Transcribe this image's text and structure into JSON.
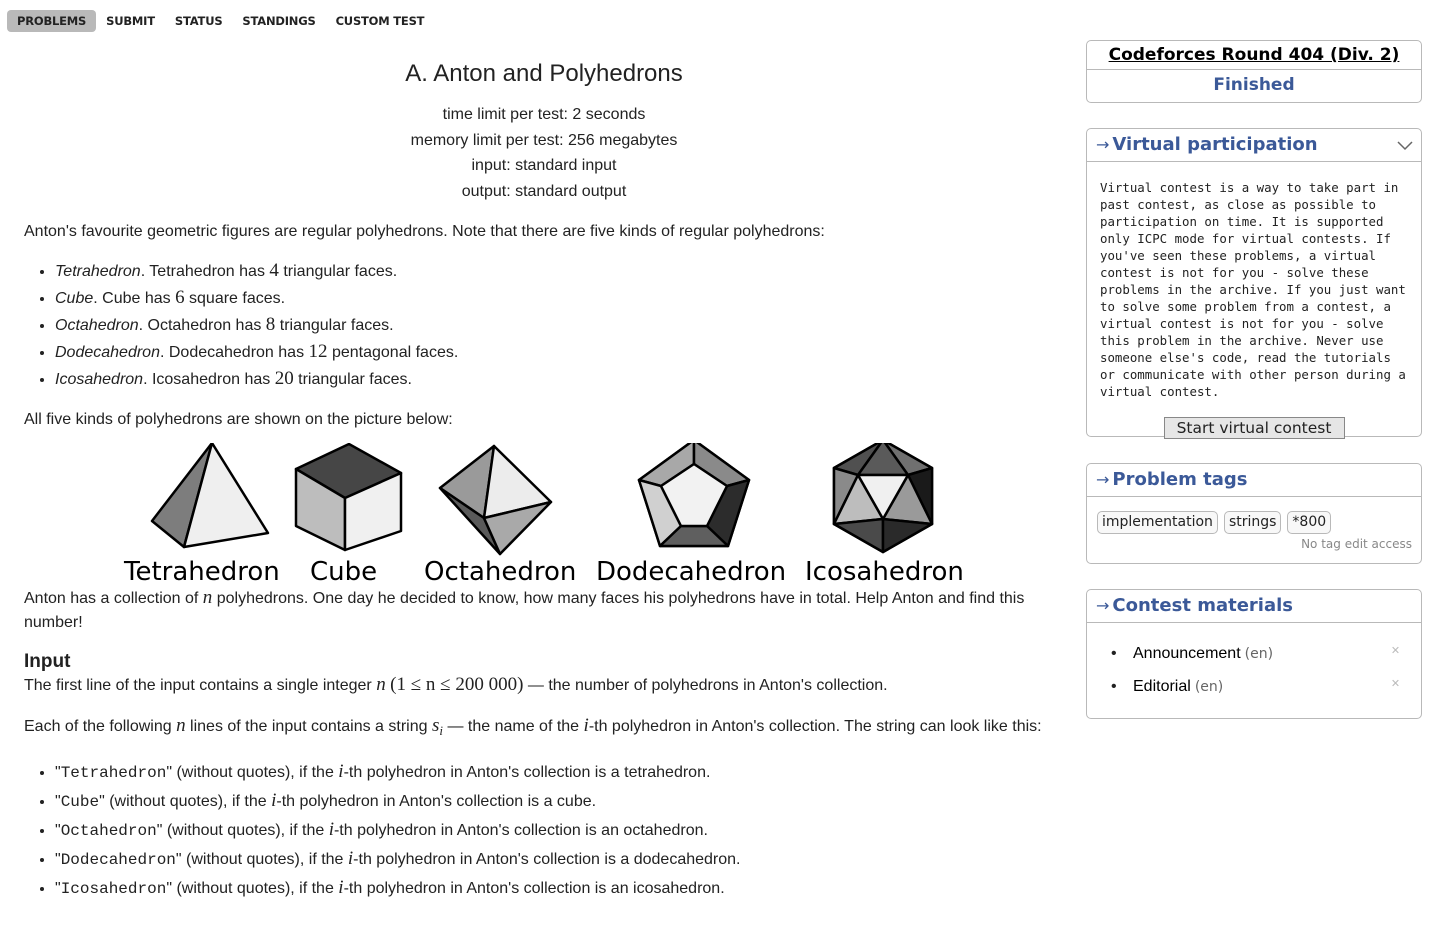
{
  "nav": {
    "items": [
      "PROBLEMS",
      "SUBMIT",
      "STATUS",
      "STANDINGS",
      "CUSTOM TEST"
    ],
    "active": "PROBLEMS"
  },
  "problem": {
    "title": "A. Anton and Polyhedrons",
    "limits": [
      "time limit per test: 2 seconds",
      "memory limit per test: 256 megabytes",
      "input: standard input",
      "output: standard output"
    ],
    "intro": "Anton's favourite geometric figures are regular polyhedrons. Note that there are five kinds of regular polyhedrons:",
    "kinds": [
      {
        "name": "Tetrahedron",
        "t1": ". Tetrahedron has ",
        "count": "4",
        "t2": " triangular faces."
      },
      {
        "name": "Cube",
        "t1": ". Cube has ",
        "count": "6",
        "t2": " square faces."
      },
      {
        "name": "Octahedron",
        "t1": ". Octahedron has ",
        "count": "8",
        "t2": " triangular faces."
      },
      {
        "name": "Dodecahedron",
        "t1": ". Dodecahedron has ",
        "count": "12",
        "t2": " pentagonal faces."
      },
      {
        "name": "Icosahedron",
        "t1": ". Icosahedron has ",
        "count": "20",
        "t2": " triangular faces."
      }
    ],
    "picture_intro": "All five kinds of polyhedrons are shown on the picture below:",
    "figure_labels": [
      "Tetrahedron",
      "Cube",
      "Octahedron",
      "Dodecahedron",
      "Icosahedron"
    ],
    "story": {
      "a": "Anton has a collection of ",
      "var": "n",
      "b": " polyhedrons. One day he decided to know, how many faces his polyhedrons have in total. Help Anton and find this number!"
    },
    "input_title": "Input",
    "input_p1": {
      "a": "The first line of the input contains a single integer ",
      "var": "n",
      "constraint": "(1 ≤ n ≤ 200 000)",
      "b": " — the number of polyhedrons in Anton's collection."
    },
    "input_p2": {
      "a": "Each of the following ",
      "var_n": "n",
      "b": " lines of the input contains a string ",
      "var_s": "s",
      "sub": "i",
      "c": " — the name of the ",
      "var_i": "i",
      "d": "-th polyhedron in Anton's collection. The string can look like this:"
    },
    "strings": [
      {
        "code": "Tetrahedron",
        "a": "\" (without quotes), if the ",
        "var": "i",
        "b": "-th polyhedron in Anton's collection is a tetrahedron."
      },
      {
        "code": "Cube",
        "a": "\" (without quotes), if the ",
        "var": "i",
        "b": "-th polyhedron in Anton's collection is a cube."
      },
      {
        "code": "Octahedron",
        "a": "\" (without quotes), if the ",
        "var": "i",
        "b": "-th polyhedron in Anton's collection is an octahedron."
      },
      {
        "code": "Dodecahedron",
        "a": "\" (without quotes), if the ",
        "var": "i",
        "b": "-th polyhedron in Anton's collection is a dodecahedron."
      },
      {
        "code": "Icosahedron",
        "a": "\" (without quotes), if the ",
        "var": "i",
        "b": "-th polyhedron in Anton's collection is an icosahedron."
      }
    ]
  },
  "sidebar": {
    "contest": {
      "name": "Codeforces Round 404 (Div. 2)",
      "status": "Finished"
    },
    "virtual": {
      "title": "Virtual participation",
      "description": "Virtual contest is a way to take part in past contest, as close as possible to participation on time. It is supported only ICPC mode for virtual contests. If you've seen these problems, a virtual contest is not for you - solve these problems in the archive. If you just want to solve some problem from a contest, a virtual contest is not for you - solve this problem in the archive. Never use someone else's code, read the tutorials or communicate with other person during a virtual contest.",
      "button": "Start virtual contest"
    },
    "tags": {
      "title": "Problem tags",
      "items": [
        "implementation",
        "strings",
        "*800"
      ],
      "note": "No tag edit access"
    },
    "materials": {
      "title": "Contest materials",
      "items": [
        {
          "label": "Announcement",
          "lang": "(en)"
        },
        {
          "label": "Editorial",
          "lang": "(en)"
        }
      ]
    }
  }
}
